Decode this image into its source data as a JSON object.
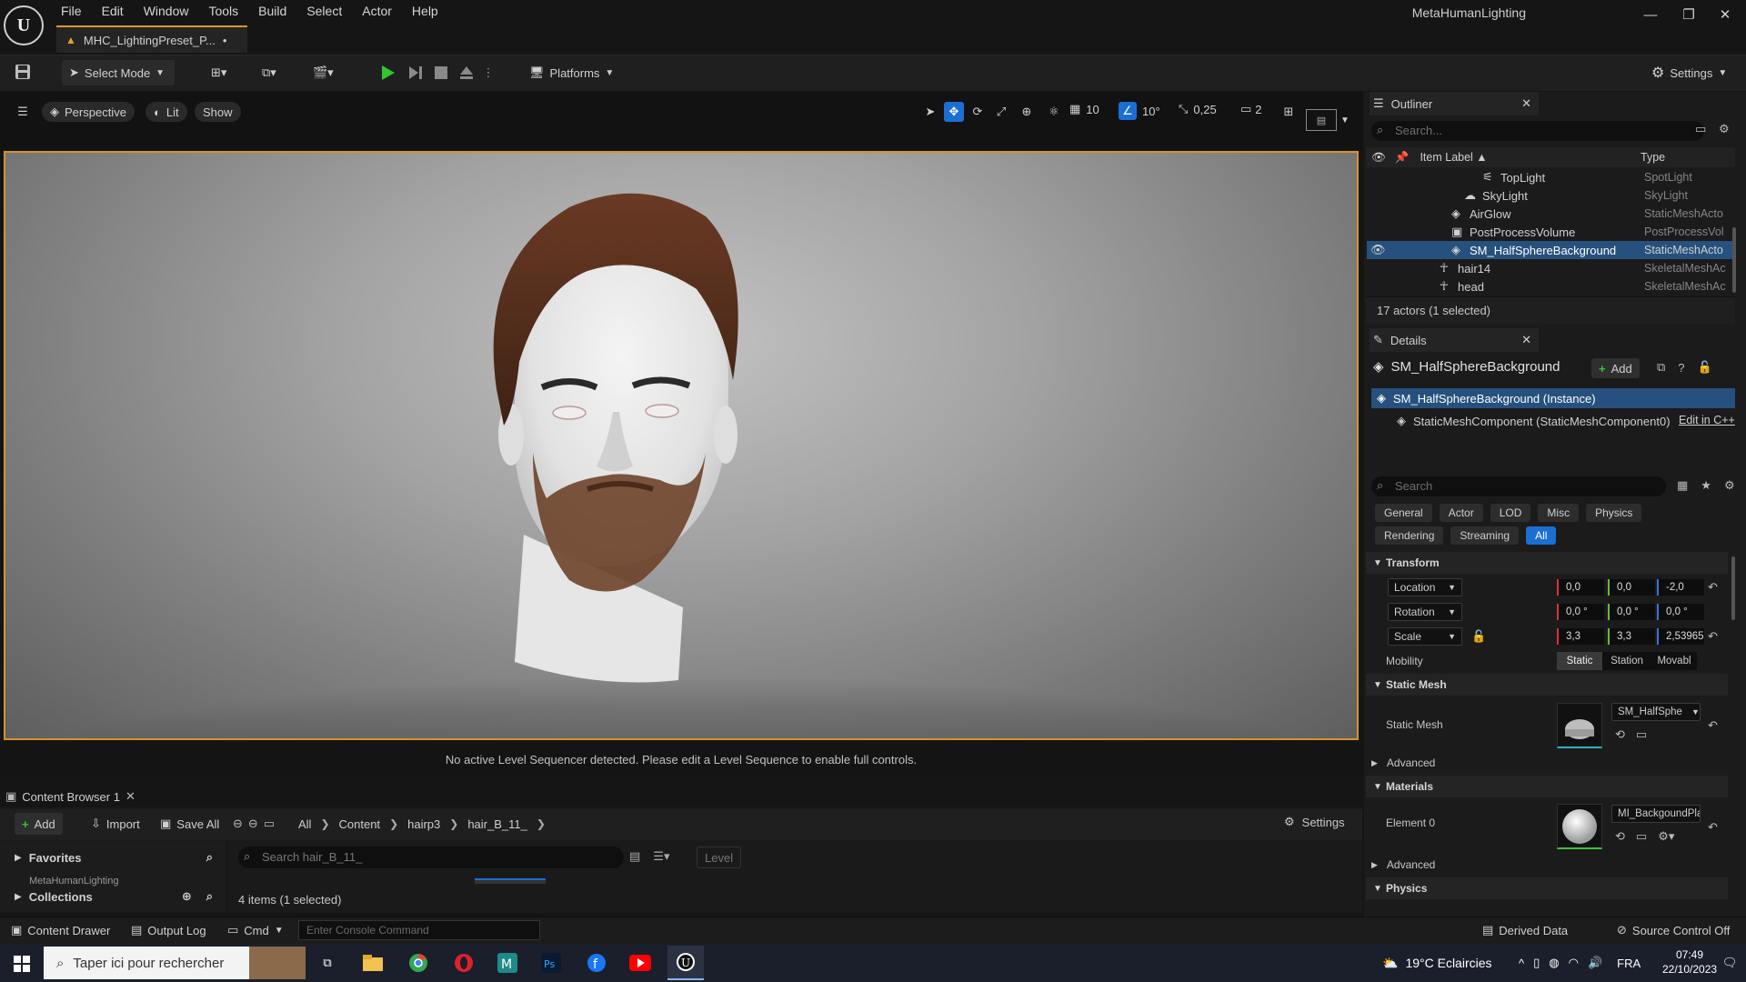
{
  "window": {
    "project_name": "MetaHumanLighting",
    "document_tab": "MHC_LightingPreset_P...",
    "dirty_marker": "•"
  },
  "menu": [
    "File",
    "Edit",
    "Window",
    "Tools",
    "Build",
    "Select",
    "Actor",
    "Help"
  ],
  "toolbar": {
    "select_mode": "Select Mode",
    "platforms": "Platforms",
    "settings": "Settings"
  },
  "viewport": {
    "perspective": "Perspective",
    "lit": "Lit",
    "show": "Show",
    "grid_snap": "10",
    "rotation_snap": "10°",
    "scale_snap": "0,25",
    "camera_speed": "2",
    "sequencer_message": "No active Level Sequencer detected. Please edit a Level Sequence to enable full controls."
  },
  "content_browser": {
    "tab_label": "Content Browser 1",
    "add": "Add",
    "import": "Import",
    "save_all": "Save All",
    "breadcrumb": [
      "All",
      "Content",
      "hairp3",
      "hair_B_11_"
    ],
    "settings": "Settings",
    "favorites": "Favorites",
    "project_folder": "MetaHumanLighting",
    "collections": "Collections",
    "search_placeholder": "Search hair_B_11_",
    "filter_chip": "Level",
    "items_count": "4 items (1 selected)"
  },
  "statusbar": {
    "content_drawer": "Content Drawer",
    "output_log": "Output Log",
    "cmd": "Cmd",
    "console_placeholder": "Enter Console Command",
    "derived_data": "Derived Data",
    "source_control": "Source Control Off"
  },
  "outliner": {
    "title": "Outliner",
    "search_placeholder": "Search...",
    "col_label": "Item Label ▲",
    "col_type": "Type",
    "rows": [
      {
        "label": "TopLight",
        "type": "SpotLight",
        "icon": "spotlight-icon"
      },
      {
        "label": "SkyLight",
        "type": "SkyLight",
        "icon": "skylight-icon"
      },
      {
        "label": "AirGlow",
        "type": "StaticMeshActo",
        "icon": "static-mesh-icon"
      },
      {
        "label": "PostProcessVolume",
        "type": "PostProcessVol",
        "icon": "volume-icon"
      },
      {
        "label": "SM_HalfSphereBackground",
        "type": "StaticMeshActo",
        "icon": "static-mesh-icon",
        "selected": true
      },
      {
        "label": "hair14",
        "type": "SkeletalMeshAc",
        "icon": "skeletal-mesh-icon"
      },
      {
        "label": "head",
        "type": "SkeletalMeshAc",
        "icon": "skeletal-mesh-icon"
      }
    ],
    "footer": "17 actors (1 selected)"
  },
  "details": {
    "title": "Details",
    "actor_name": "SM_HalfSphereBackground",
    "add": "Add",
    "instance": "SM_HalfSphereBackground (Instance)",
    "component": "StaticMeshComponent (StaticMeshComponent0)",
    "edit_cpp": "Edit in C++",
    "search_placeholder": "Search",
    "categories": [
      "General",
      "Actor",
      "LOD",
      "Misc",
      "Physics",
      "Rendering",
      "Streaming",
      "All"
    ],
    "active_category": "All",
    "transform_header": "Transform",
    "location_label": "Location",
    "location": [
      "0,0",
      "0,0",
      "-2,0"
    ],
    "rotation_label": "Rotation",
    "rotation": [
      "0,0 °",
      "0,0 °",
      "0,0 °"
    ],
    "scale_label": "Scale",
    "scale": [
      "3,3",
      "3,3",
      "2,53965"
    ],
    "mobility_label": "Mobility",
    "mobility_options": [
      "Static",
      "Station",
      "Movabl"
    ],
    "mobility_selected": "Static",
    "static_mesh_header": "Static Mesh",
    "static_mesh_label": "Static Mesh",
    "static_mesh_value": "SM_HalfSphe",
    "advanced": "Advanced",
    "materials_header": "Materials",
    "element0_label": "Element 0",
    "element0_value": "MI_BackgoundPlan",
    "advanced2": "Advanced",
    "physics_header": "Physics"
  },
  "taskbar": {
    "search_placeholder": "Taper ici pour rechercher",
    "weather": "19°C  Eclaircies",
    "language": "FRA",
    "time": "07:49",
    "date": "22/10/2023"
  },
  "colors": {
    "accent_orange": "#d5932c",
    "selection_blue": "#26517e",
    "active_blue": "#1b6fd3",
    "play_green": "#34c431"
  }
}
